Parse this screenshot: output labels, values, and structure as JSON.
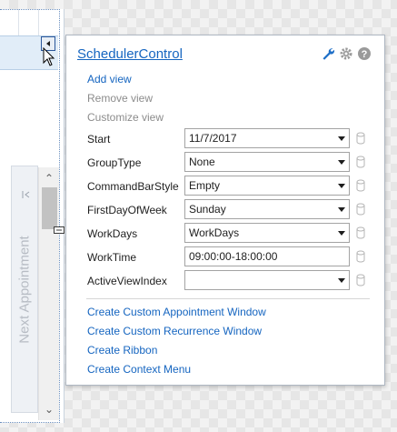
{
  "designer": {
    "next_appointment_label": "Next Appointment"
  },
  "popup": {
    "title": "SchedulerControl",
    "icons": [
      "wrench-icon",
      "gear-icon",
      "help-icon"
    ],
    "actions_top": [
      {
        "label": "Add view",
        "enabled": true
      },
      {
        "label": "Remove view",
        "enabled": false
      },
      {
        "label": "Customize view",
        "enabled": false
      }
    ],
    "properties": [
      {
        "label": "Start",
        "value": "11/7/2017",
        "dropdown": true
      },
      {
        "label": "GroupType",
        "value": "None",
        "dropdown": true
      },
      {
        "label": "CommandBarStyle",
        "value": "Empty",
        "dropdown": true
      },
      {
        "label": "FirstDayOfWeek",
        "value": "Sunday",
        "dropdown": true
      },
      {
        "label": "WorkDays",
        "value": "WorkDays",
        "dropdown": true
      },
      {
        "label": "WorkTime",
        "value": "09:00:00-18:00:00",
        "dropdown": false
      },
      {
        "label": "ActiveViewIndex",
        "value": "",
        "dropdown": true
      }
    ],
    "actions_bottom": [
      {
        "label": "Create Custom Appointment Window"
      },
      {
        "label": "Create Custom Recurrence Window"
      },
      {
        "label": "Create Ribbon"
      },
      {
        "label": "Create Context Menu"
      }
    ],
    "colors": {
      "link": "#1565c0",
      "disabled": "#8c8c8c",
      "border": "#aeb7c2"
    }
  }
}
